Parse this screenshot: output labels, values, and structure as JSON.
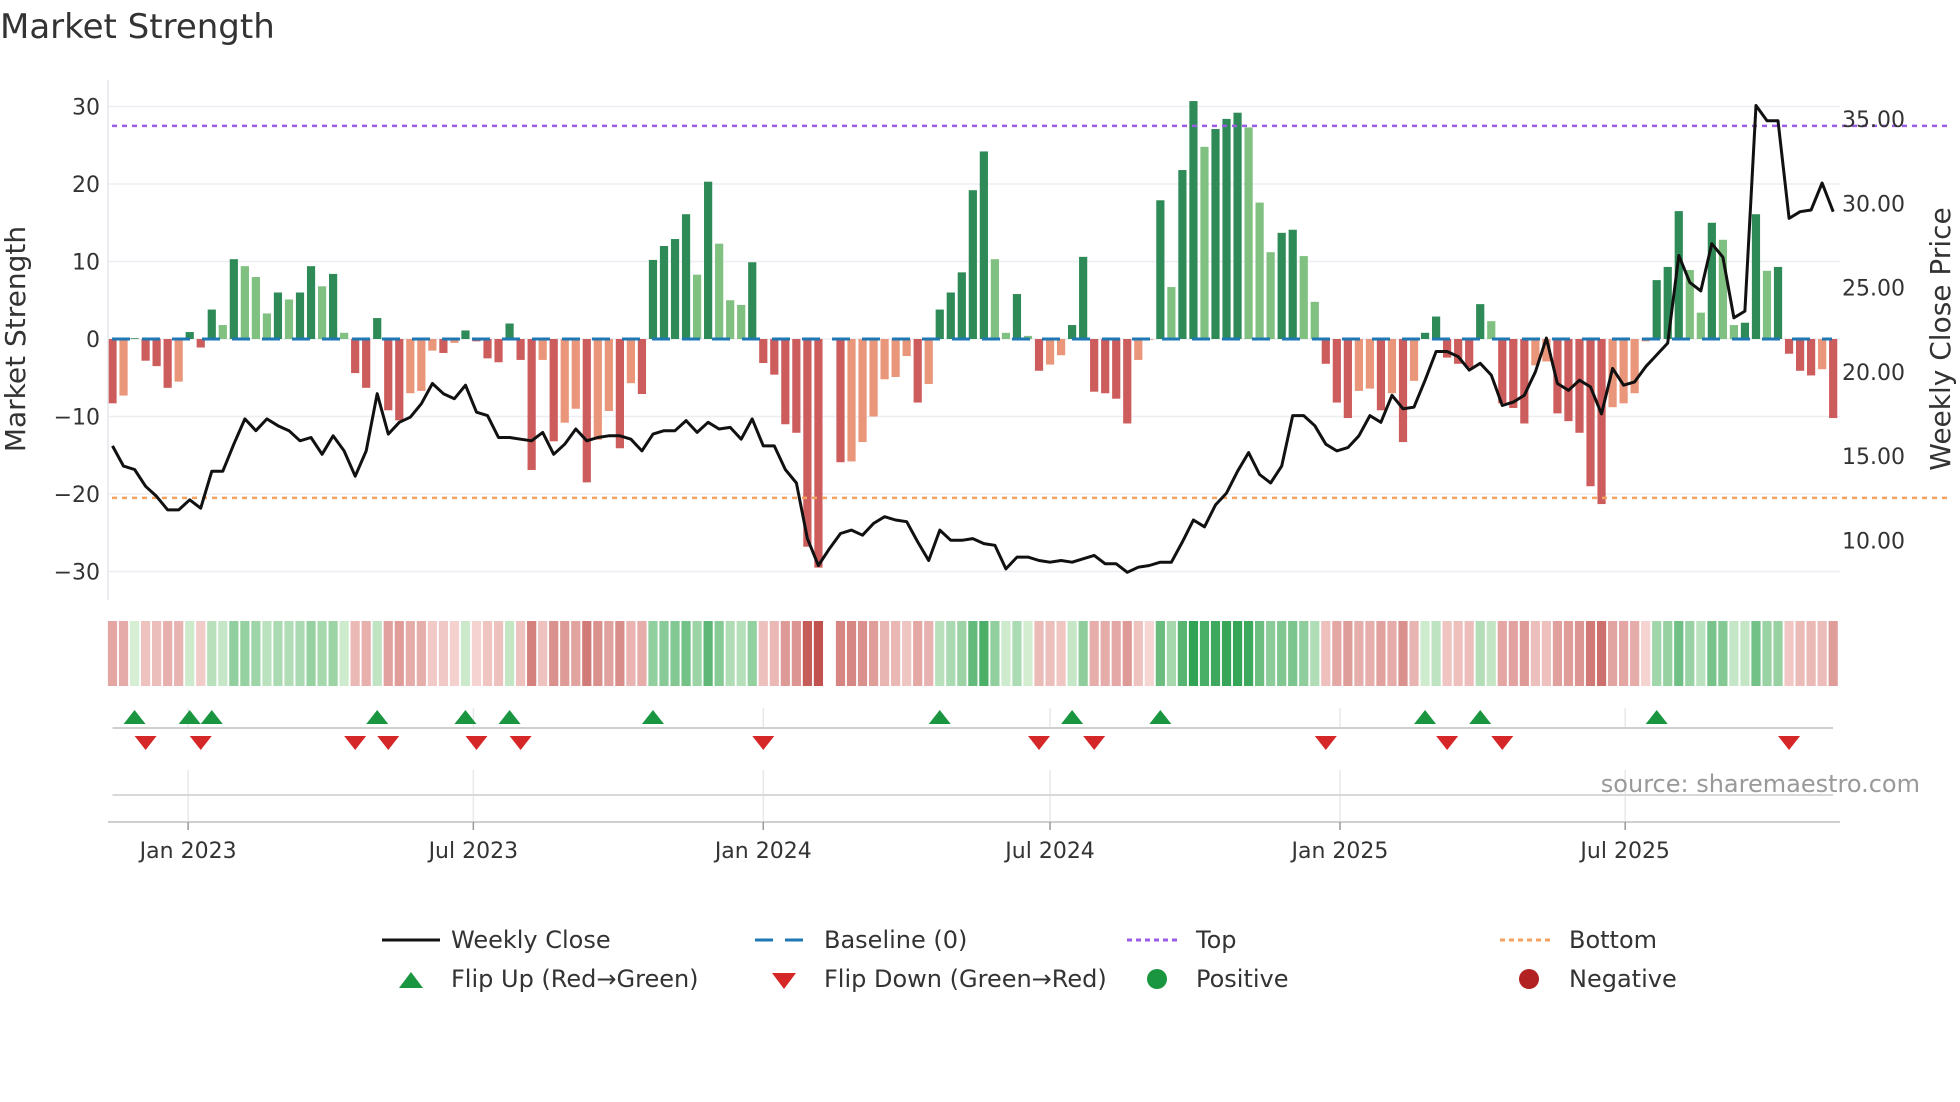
{
  "chart_data": {
    "type": "bar",
    "title": "Market Strength",
    "ylabel": "Market Strength",
    "y2label": "Weekly Close Price",
    "ylim": [
      -33,
      33
    ],
    "y2lim": [
      7.5,
      36.5
    ],
    "yticks": [
      "30",
      "20",
      "10",
      "0",
      "−10",
      "−20",
      "−30"
    ],
    "ytick_values": [
      30,
      20,
      10,
      0,
      -10,
      -20,
      -30
    ],
    "y2ticks": [
      "35.00",
      "30.00",
      "25.00",
      "20.00",
      "15.00",
      "10.00"
    ],
    "y2tick_values": [
      35,
      30,
      25,
      20,
      15,
      10
    ],
    "xticks": [
      "Jan 2023",
      "Jul 2023",
      "Jan 2024",
      "Jul 2024",
      "Jan 2025",
      "Jul 2025"
    ],
    "xtick_dates": [
      "2023-01-01",
      "2023-07-01",
      "2024-01-01",
      "2024-07-01",
      "2025-01-01",
      "2025-07-01"
    ],
    "start_date": "2022-11-14",
    "frequency": "weekly",
    "grid": true,
    "legend_position": "bottom",
    "top_level": 27.5,
    "bottom_level": -20.5,
    "baseline": 0,
    "strength": [
      -8.3,
      -7.3,
      0.1,
      -2.8,
      -3.5,
      -6.3,
      -5.5,
      0.9,
      -1.1,
      3.8,
      1.8,
      10.3,
      9.4,
      8.0,
      3.3,
      6.0,
      5.1,
      6.0,
      9.4,
      6.8,
      8.4,
      0.8,
      -4.4,
      -6.3,
      2.7,
      -9.2,
      -10.5,
      -7.0,
      -6.7,
      -1.5,
      -1.8,
      -0.5,
      1.1,
      -0.3,
      -2.5,
      -3.0,
      2.0,
      -2.7,
      -16.9,
      -2.7,
      -13.2,
      -10.8,
      -9.0,
      -18.5,
      -13.0,
      -9.3,
      -14.1,
      -5.7,
      -7.1,
      10.2,
      12.0,
      12.9,
      16.1,
      8.3,
      20.3,
      12.3,
      5.0,
      4.4,
      9.9,
      -3.1,
      -4.6,
      -11.0,
      -12.1,
      -26.8,
      -29.5,
      null,
      -15.9,
      -15.8,
      -13.3,
      -10.0,
      -5.2,
      -4.9,
      -2.2,
      -8.2,
      -5.8,
      3.8,
      6.0,
      8.6,
      19.2,
      24.2,
      10.3,
      0.8,
      5.8,
      0.4,
      -4.1,
      -3.3,
      -2.1,
      1.8,
      10.6,
      -6.8,
      -7.0,
      -7.7,
      -10.9,
      -2.7,
      0,
      17.9,
      6.7,
      21.8,
      30.7,
      24.8,
      27.1,
      28.4,
      29.2,
      27.3,
      17.6,
      11.2,
      13.7,
      14.1,
      10.7,
      4.8,
      -3.2,
      -8.2,
      -10.2,
      -6.7,
      -6.4,
      -9.2,
      -7.0,
      -13.3,
      -5.4,
      0.8,
      2.9,
      -2.4,
      -3.2,
      -3.7,
      4.5,
      2.3,
      -8.3,
      -8.9,
      -10.9,
      -3.4,
      -2.9,
      -9.6,
      -10.6,
      -12.1,
      -19.0,
      -21.3,
      -8.8,
      -8.3,
      -7.0,
      -0.3,
      7.6,
      9.3,
      16.5,
      8.9,
      3.4,
      15.0,
      12.8,
      1.8,
      2.1,
      16.1,
      8.8,
      9.3,
      -1.9,
      -4.1,
      -4.7,
      -3.9,
      -10.2
    ],
    "weekly_close": [
      15.6,
      14.4,
      14.2,
      13.2,
      12.6,
      11.8,
      11.8,
      12.4,
      11.9,
      14.1,
      14.1,
      15.7,
      17.2,
      16.5,
      17.2,
      16.8,
      16.5,
      15.9,
      16.1,
      15.1,
      16.2,
      15.3,
      13.8,
      15.3,
      18.7,
      16.3,
      17.0,
      17.3,
      18.1,
      19.3,
      18.7,
      18.4,
      19.2,
      17.6,
      17.4,
      16.1,
      16.1,
      16.0,
      15.9,
      16.4,
      15.1,
      15.7,
      16.6,
      15.9,
      16.1,
      16.2,
      16.2,
      16.0,
      15.3,
      16.3,
      16.5,
      16.5,
      17.1,
      16.4,
      17.0,
      16.6,
      16.7,
      16.0,
      17.2,
      15.6,
      15.6,
      14.2,
      13.4,
      10.1,
      8.5,
      9.5,
      10.4,
      10.6,
      10.3,
      11.0,
      11.4,
      11.2,
      11.1,
      9.9,
      8.8,
      10.6,
      10.0,
      10.0,
      10.1,
      9.8,
      9.7,
      8.3,
      9.0,
      9.0,
      8.8,
      8.7,
      8.8,
      8.7,
      8.9,
      9.1,
      8.6,
      8.6,
      8.1,
      8.4,
      8.5,
      8.7,
      8.7,
      9.9,
      11.2,
      10.8,
      12.1,
      12.8,
      14.1,
      15.2,
      13.9,
      13.4,
      14.4,
      17.4,
      17.4,
      16.8,
      15.7,
      15.3,
      15.5,
      16.2,
      17.4,
      17.0,
      18.6,
      17.8,
      17.9,
      19.5,
      21.2,
      21.2,
      20.9,
      20.1,
      20.5,
      19.8,
      18.0,
      18.2,
      18.6,
      20.0,
      22.0,
      19.3,
      18.9,
      19.5,
      19.1,
      17.5,
      20.2,
      19.2,
      19.4,
      20.3,
      21.0,
      21.7,
      26.9,
      25.3,
      24.8,
      27.6,
      26.8,
      23.2,
      23.6,
      35.8,
      34.9,
      34.9,
      29.1,
      29.5,
      29.6,
      31.2,
      29.5
    ],
    "flip_up_weeks": [
      3,
      8,
      10,
      25,
      33,
      37,
      50,
      76,
      88,
      96,
      120,
      125,
      141
    ],
    "flip_down_weeks": [
      4,
      9,
      23,
      26,
      34,
      38,
      60,
      85,
      90,
      111,
      122,
      127,
      153
    ],
    "legend": [
      {
        "label": "Weekly Close"
      },
      {
        "label": "Baseline (0)"
      },
      {
        "label": "Top"
      },
      {
        "label": "Bottom"
      },
      {
        "label": "Flip Up (Red→Green)"
      },
      {
        "label": "Flip Down (Green→Red)"
      },
      {
        "label": "Positive"
      },
      {
        "label": "Negative"
      }
    ],
    "colors": {
      "pos_strong": "#2e8b57",
      "pos_weak": "#80c080",
      "neg_strong": "#cd5c5c",
      "neg_weak": "#e9967a",
      "line": "#111111",
      "baseline": "#1f77b4",
      "top": "#9b5de5",
      "bottom": "#f4a261",
      "flip_up": "#1a9641",
      "flip_down": "#d62728",
      "positive_dot": "#1a9641",
      "negative_dot": "#b22222"
    }
  },
  "source": "source: sharemaestro.com"
}
